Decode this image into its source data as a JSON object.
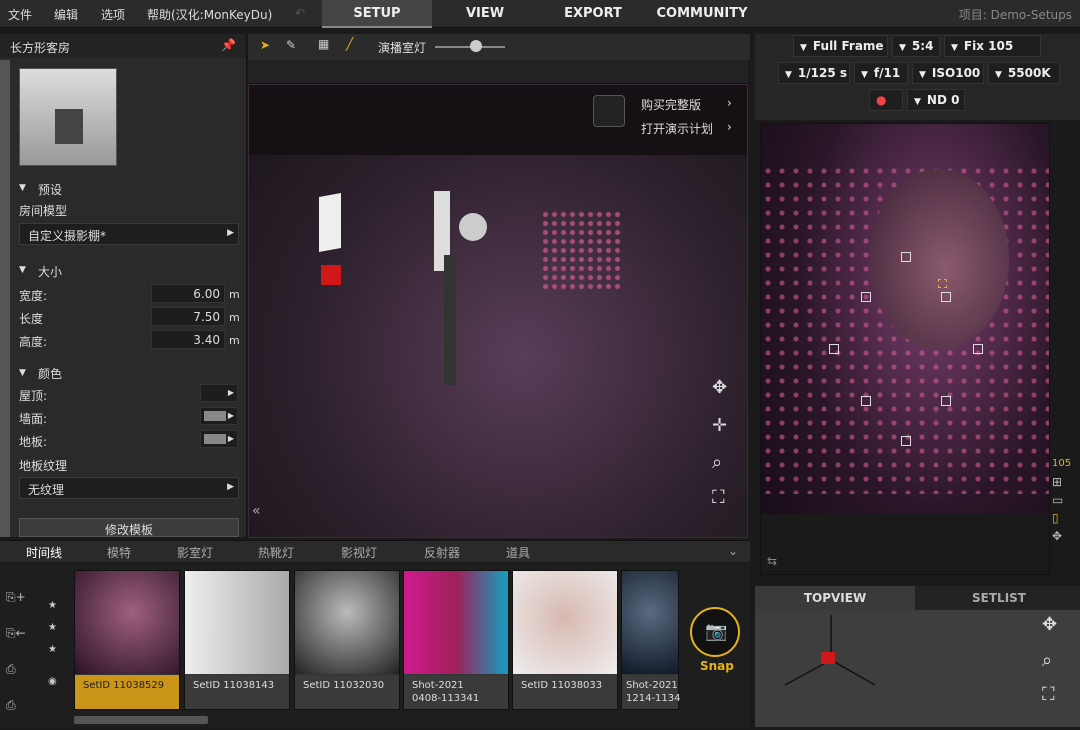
{
  "menu": {
    "file": "文件",
    "edit": "编辑",
    "options": "选项",
    "help": "帮助(汉化:MonKeyDu)"
  },
  "main_tabs": [
    "SETUP",
    "VIEW",
    "EXPORT",
    "COMMUNITY"
  ],
  "project": "项目: Demo-Setups",
  "left": {
    "title": "长方形客房",
    "preset_section": "预设",
    "room_model_label": "房间模型",
    "room_model_value": "自定义摄影棚*",
    "size_section": "大小",
    "width_label": "宽度:",
    "width_value": "6.00",
    "length_label": "长度",
    "length_value": "7.50",
    "height_label": "高度:",
    "height_value": "3.40",
    "unit": "m",
    "color_section": "颜色",
    "roof_label": "屋顶:",
    "wall_label": "墙面:",
    "floor_label": "地板:",
    "floor_texture_label": "地板纹理",
    "floor_texture_value": "无纹理",
    "modify_template": "修改模板"
  },
  "toolbar": {
    "mode_label": "演播室灯"
  },
  "viewport": {
    "buy": "购买完整版",
    "demo": "打开演示计划"
  },
  "camera": {
    "sensor": "Full Frame",
    "ratio": "5:4",
    "lens": "Fix 105 mm",
    "shutter": "1/125 s",
    "aperture": "f/11",
    "iso": "ISO100",
    "wb": "5500K",
    "nd": "ND 0"
  },
  "bottom_tabs": [
    "时间线",
    "模特",
    "影室灯",
    "热靴灯",
    "影视灯",
    "反射器",
    "道具"
  ],
  "gallery": [
    {
      "caption": "SetID 11038529",
      "selected": true
    },
    {
      "caption": "SetID 11038143",
      "selected": false
    },
    {
      "caption": "SetID 11032030",
      "selected": false
    },
    {
      "caption": "Shot-2021\n0408-113341",
      "selected": false
    },
    {
      "caption": "SetID 11038033",
      "selected": false
    },
    {
      "caption": "Shot-2021\n1214-1134",
      "selected": false
    }
  ],
  "snap_label": "Snap",
  "view_tabs": {
    "topview": "TOPVIEW",
    "setlist": "SETLIST"
  },
  "side_badge": "105"
}
